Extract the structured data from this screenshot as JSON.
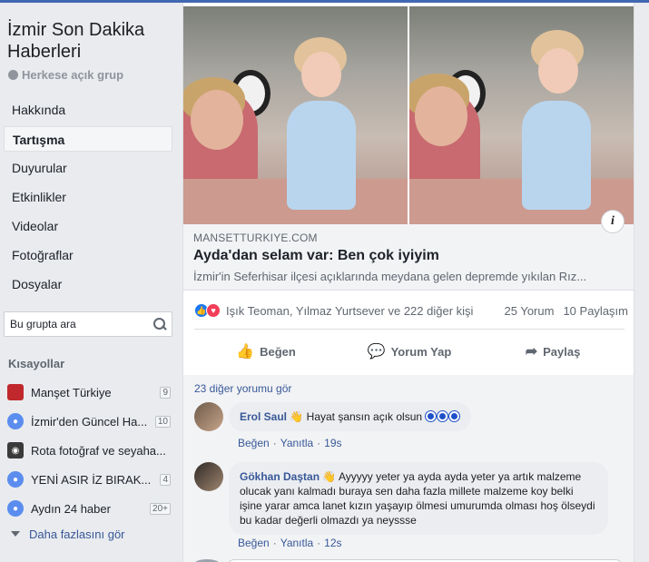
{
  "group": {
    "name": "İzmir Son Dakika Haberleri",
    "privacy": "Herkese açık grup"
  },
  "nav": {
    "items": [
      "Hakkında",
      "Tartışma",
      "Duyurular",
      "Etkinlikler",
      "Videolar",
      "Fotoğraflar",
      "Dosyalar"
    ],
    "active_index": 1
  },
  "search": {
    "placeholder": "Bu grupta ara"
  },
  "shortcuts": {
    "title": "Kısayollar",
    "items": [
      {
        "label": "Manşet Türkiye",
        "badge": "9",
        "icon": "mansetturkiye-logo-icon",
        "color": "#c0282d"
      },
      {
        "label": "İzmir'den Güncel Ha...",
        "badge": "10",
        "icon": "group-icon",
        "color": "#5b8def"
      },
      {
        "label": "Rota fotoğraf ve seyaha...",
        "badge": "",
        "icon": "camera-icon",
        "color": "#3a3a3a"
      },
      {
        "label": "YENİ ASIR İZ BIRAK...",
        "badge": "4",
        "icon": "group-icon",
        "color": "#5b8def"
      },
      {
        "label": "Aydın 24 haber",
        "badge": "20+",
        "icon": "group-icon",
        "color": "#5b8def"
      }
    ],
    "more_label": "Daha fazlasını gör"
  },
  "post": {
    "link": {
      "domain": "MANSETTURKIYE.COM",
      "title": "Ayda'dan selam var: Ben çok iyiyim",
      "description": "İzmir'in Seferhisar ilçesi açıklarında meydana gelen depremde yıkılan Rız..."
    },
    "reactions": {
      "names": "Işık Teoman, Yılmaz Yurtsever ve 222 diğer kişi",
      "comments": "25 Yorum",
      "shares": "10 Paylaşım"
    },
    "actions": {
      "like": "Beğen",
      "comment": "Yorum Yap",
      "share": "Paylaş"
    }
  },
  "comments": {
    "more_label": "23 diğer yorumu gör",
    "items": [
      {
        "author": "Erol Saul",
        "text": "Hayat şansın açık olsun",
        "like": "Beğen",
        "reply": "Yanıtla",
        "time": "19s"
      },
      {
        "author": "Gökhan Daştan",
        "text": "Ayyyyy yeter ya ayda ayda yeter ya artık malzeme olucak yanı kalmadı buraya sen daha fazla millete malzeme koy belki işine yarar amca lanet kızın yaşayıp ölmesi umurumda olması hoş ölseydi bu kadar değerli olmazdı ya neyssse",
        "like": "Beğen",
        "reply": "Yanıtla",
        "time": "12s"
      }
    ]
  },
  "colors": {
    "accent": "#385898",
    "brand": "#4267b2"
  }
}
